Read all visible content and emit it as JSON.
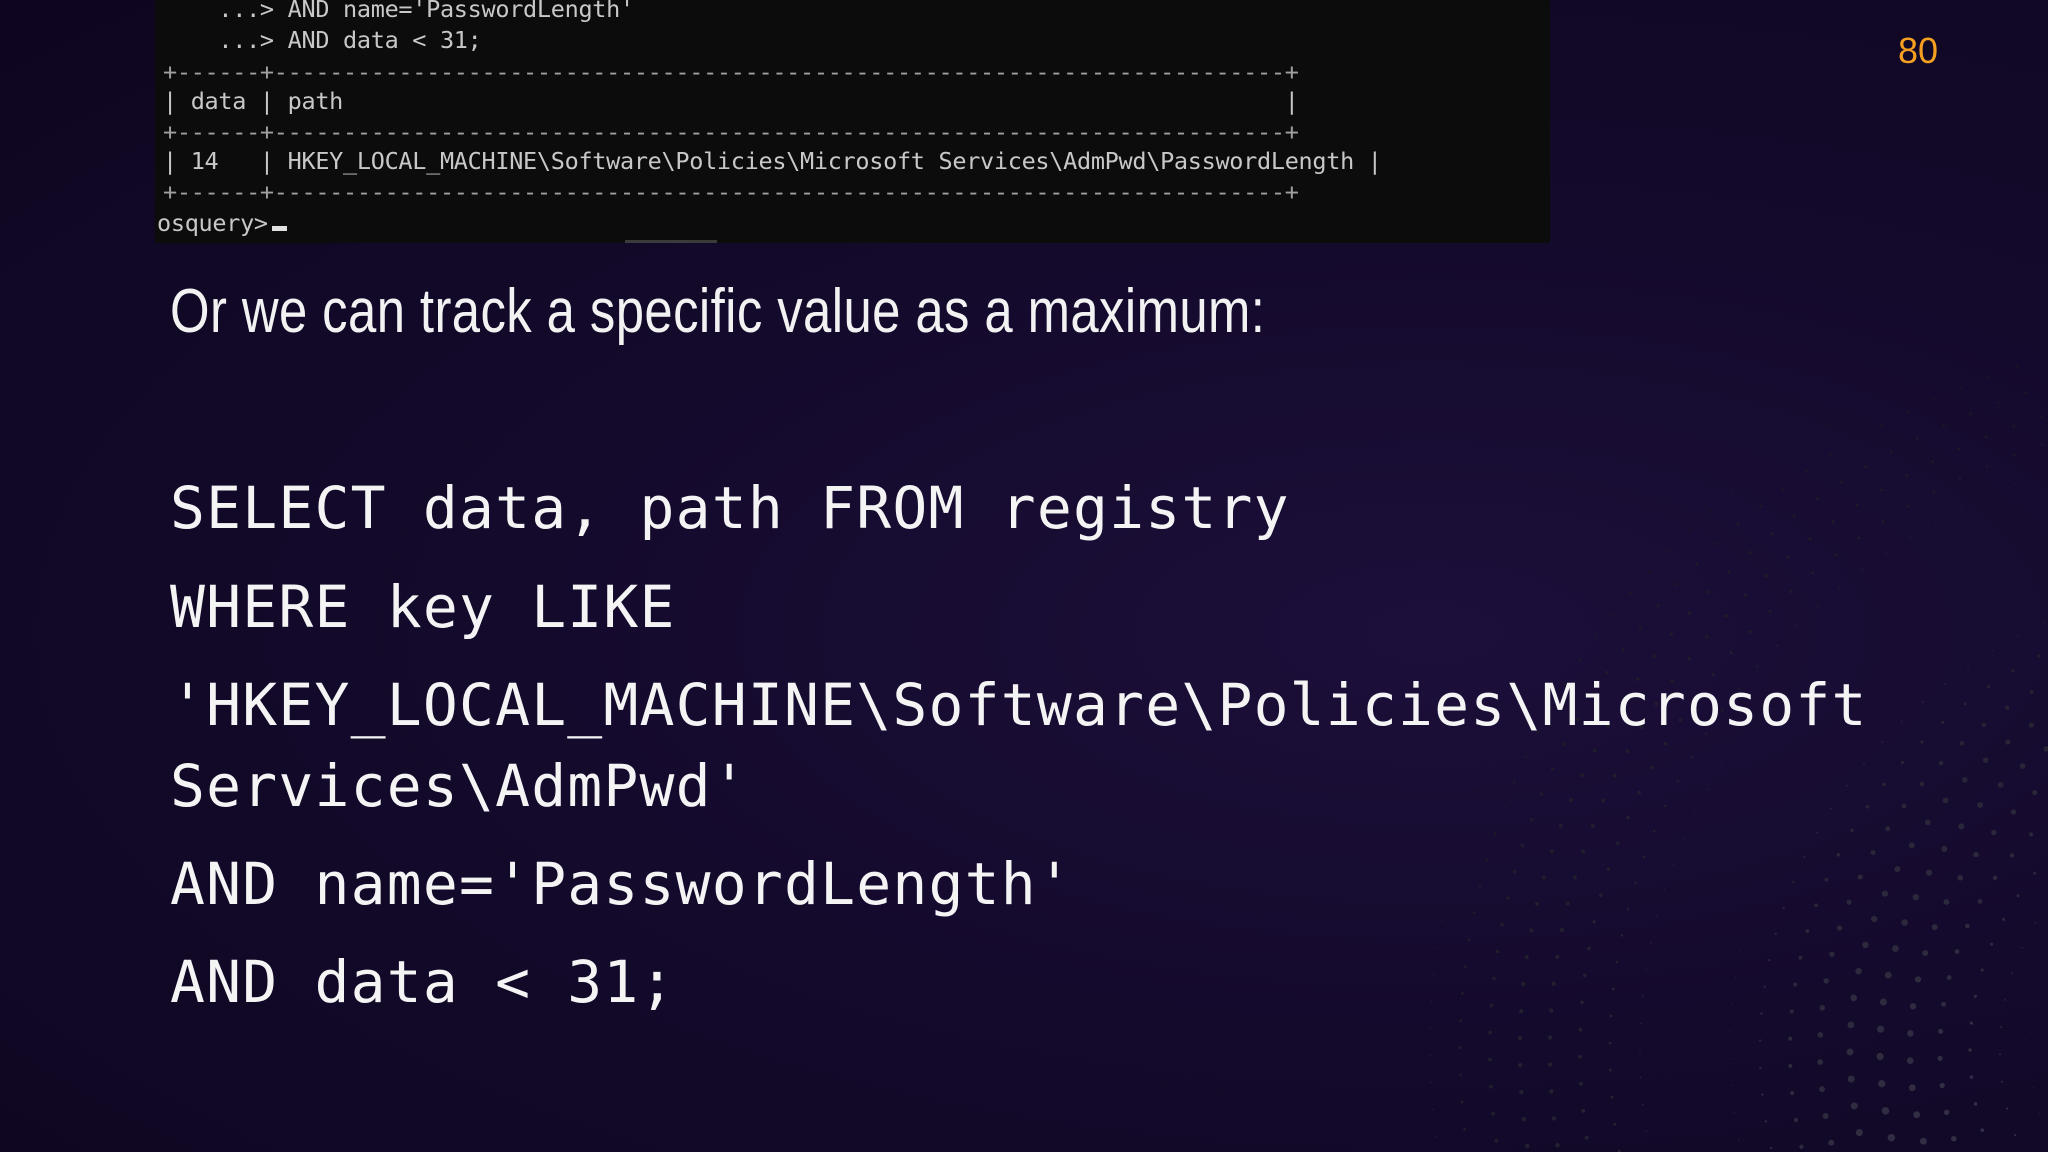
{
  "slide": {
    "number": "80",
    "heading": "Or we can track a specific value as a maximum:"
  },
  "terminal": {
    "lines": [
      "    ...> AND name='PasswordLength'",
      "    ...> AND data < 31;",
      "+------+-------------------------------------------------------------------------+",
      "| data | path                                                                    |",
      "+------+-------------------------------------------------------------------------+",
      "| 14   | HKEY_LOCAL_MACHINE\\Software\\Policies\\Microsoft Services\\AdmPwd\\PasswordLength |",
      "+------+-------------------------------------------------------------------------+"
    ],
    "prompt": "osquery>"
  },
  "code": {
    "lines": [
      "SELECT data, path FROM registry",
      "WHERE key LIKE",
      "'HKEY_LOCAL_MACHINE\\Software\\Policies\\Microsoft",
      "Services\\AdmPwd'",
      "AND name='PasswordLength'",
      "AND data < 31;"
    ]
  },
  "colors": {
    "background": "#140a2c",
    "accent": "#f5a021",
    "terminal_bg": "#0c0c0c",
    "text": "#f4f4f4"
  }
}
